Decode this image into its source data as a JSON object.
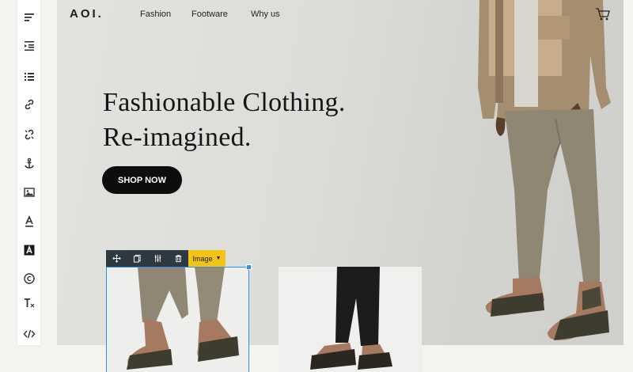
{
  "header": {
    "logo": "AOI.",
    "nav": [
      {
        "label": "Fashion"
      },
      {
        "label": "Footware"
      },
      {
        "label": "Why us"
      }
    ]
  },
  "hero": {
    "headline_line1": "Fashionable Clothing.",
    "headline_line2": "Re-imagined.",
    "cta_label": "SHOP NOW"
  },
  "image_toolbar": {
    "type_label": "Image",
    "buttons": [
      "move-icon",
      "copy-icon",
      "adjust-icon",
      "trash-icon"
    ]
  },
  "sidebar": {
    "tools": [
      "align-left-icon",
      "indent-icon",
      "list-icon",
      "link-icon",
      "unlink-icon",
      "anchor-icon",
      "image-icon",
      "text-color-icon",
      "text-background-icon",
      "copyright-icon",
      "clear-format-icon",
      "code-icon"
    ]
  },
  "colors": {
    "accent_selection": "#2f8ef2",
    "toolbar_dark": "#2e3840",
    "toolbar_yellow": "#f3c316",
    "cta_background": "#0d0d0d"
  }
}
